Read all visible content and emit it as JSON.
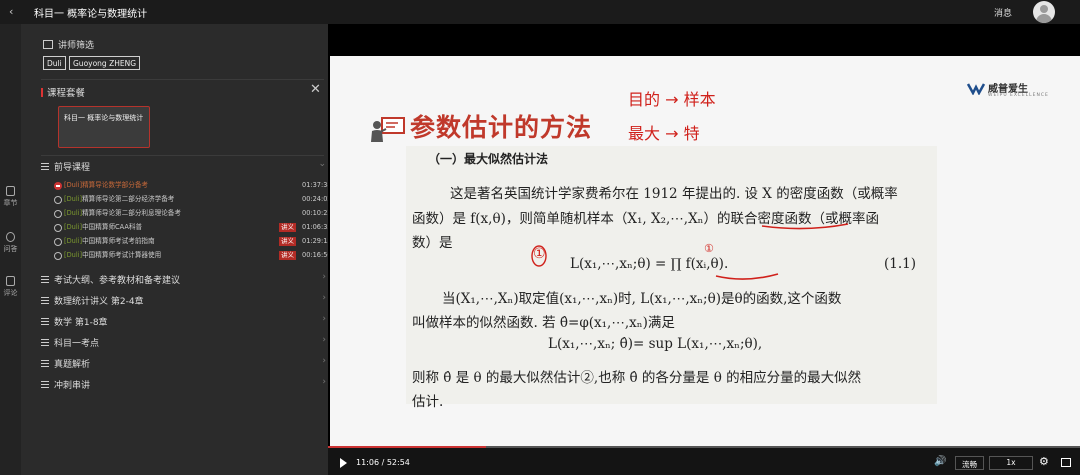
{
  "app": {
    "back_glyph": "‹",
    "title": "科目一 概率论与数理统计",
    "messages": "消息"
  },
  "rail": [
    {
      "icon": "chapter-icon",
      "label": "章节"
    },
    {
      "icon": "question-icon",
      "label": "问答"
    },
    {
      "icon": "comment-icon",
      "label": "评论"
    }
  ],
  "sidebar": {
    "filter_label": "讲师筛选",
    "tags": [
      "Duli",
      "Guoyong ZHENG"
    ],
    "package_title": "课程套餐",
    "close_glyph": "✕",
    "package_card": "科目一 概率论与数理统计",
    "prereq_title": "前导课程",
    "lessons": [
      {
        "src": "[Duli]",
        "name": "精算导论数学部分备考",
        "badge": "",
        "time": "01:37:38",
        "current": true
      },
      {
        "src": "[Duli]",
        "name": "精算师导论第二部分经济学备考",
        "badge": "",
        "time": "00:24:02",
        "current": false
      },
      {
        "src": "[Duli]",
        "name": "精算师导论第二部分利息理论备考",
        "badge": "",
        "time": "00:10:22",
        "current": false
      },
      {
        "src": "[Duli]",
        "name": "中国精算师CAA科普",
        "badge": "讲义",
        "time": "01:06:35",
        "current": false
      },
      {
        "src": "[Duli]",
        "name": "中国精算师考试考前指南",
        "badge": "讲义",
        "time": "01:29:13",
        "current": false
      },
      {
        "src": "[Duli]",
        "name": "中国精算师考试计算器使用",
        "badge": "讲义",
        "time": "00:16:50",
        "current": false
      }
    ],
    "sections": [
      "考试大纲、参考教材和备考建议",
      "数理统计讲义 第2-4章",
      "数学 第1-8章",
      "科目一考点",
      "真题解析",
      "冲刺串讲"
    ]
  },
  "slide": {
    "title": "参数估计的方法",
    "logo": "威普爱生",
    "logo_sub": "WEIPU EXCELLENCE",
    "section_heading": "（一）最大似然估计法",
    "lines": [
      "这是著名英国统计学家费希尔在 1912 年提出的. 设 X 的密度函数（或概率",
      "函数）是 f(x,θ)，则简单随机样本（X₁, X₂,⋯,Xₙ）的联合密度函数（或概率函",
      "数）是",
      "L(x₁,⋯,xₙ;θ) = ∏ f(xᵢ,θ).",
      "(1.1)",
      "当(X₁,⋯,Xₙ)取定值(x₁,⋯,xₙ)时, L(x₁,⋯,xₙ;θ)是θ的函数,这个函数",
      "叫做样本的似然函数. 若 θ̂=φ(x₁,⋯,xₙ)满足",
      "L(x₁,⋯,xₙ; θ̂)= sup L(x₁,⋯,xₙ;θ),",
      "则称 θ̂ 是 θ 的最大似然估计②,也称 θ̂ 的各分量是 θ 的相应分量的最大似然",
      "估计."
    ],
    "annotations": [
      "目的 → 样本",
      "最大 → 特",
      "①",
      "①"
    ]
  },
  "player": {
    "time": "11:06 / 52:54",
    "progress": 0.21,
    "quality": "流畅",
    "speed": "1x"
  },
  "colors": {
    "accent": "#c0392b",
    "handwriting": "#d0211b"
  }
}
